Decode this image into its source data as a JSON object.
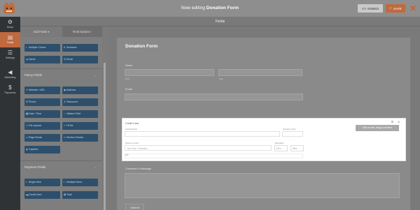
{
  "topbar": {
    "editing_prefix": "Now editing",
    "form_name": "Donation Form",
    "embed_label": "EMBED",
    "save_label": "SAVE",
    "close_glyph": "✕"
  },
  "nav": [
    {
      "label": "Setup",
      "icon": "gear-icon",
      "glyph": "⚙"
    },
    {
      "label": "Fields",
      "icon": "fields-icon",
      "glyph": "▤"
    },
    {
      "label": "Settings",
      "icon": "sliders-icon",
      "glyph": "☰"
    },
    {
      "label": "Marketing",
      "icon": "megaphone-icon",
      "glyph": "📣"
    },
    {
      "label": "Payments",
      "icon": "dollar-icon",
      "glyph": "$"
    }
  ],
  "fields_bar": "Fields",
  "panel": {
    "tab_add": "Add Fields ▾",
    "tab_options": "Field Options ›",
    "standard": [
      "Multiple Choice",
      "Numbers",
      "Name",
      "Email"
    ],
    "fancy_title": "Fancy Fields",
    "fancy": [
      "Website / URL",
      "Address",
      "Phone",
      "Password",
      "Date / Time",
      "Hidden Field",
      "File Upload",
      "HTML",
      "Page Break",
      "Section Divider",
      "Captcha"
    ],
    "payment_title": "Payment Fields",
    "payment": [
      "Single Item",
      "Multiple Items",
      "Credit Card",
      "Total"
    ]
  },
  "form": {
    "title": "Donation Form",
    "name_label": "Name",
    "first_sub": "First",
    "last_sub": "Last",
    "email_label": "Email",
    "cc_label": "Credit Card",
    "card_number": "Card Number",
    "security_code": "Security Code",
    "name_on_card": "Name on Card",
    "name_placeholder": "Jane Doe / Jhonatan",
    "expiration": "Expiration",
    "month": "12",
    "year": "25",
    "zip": "ZIP",
    "cc_button": "Click to edit. Drag to reorder.",
    "comment_label": "Comment or Message",
    "submit": "Submit"
  }
}
